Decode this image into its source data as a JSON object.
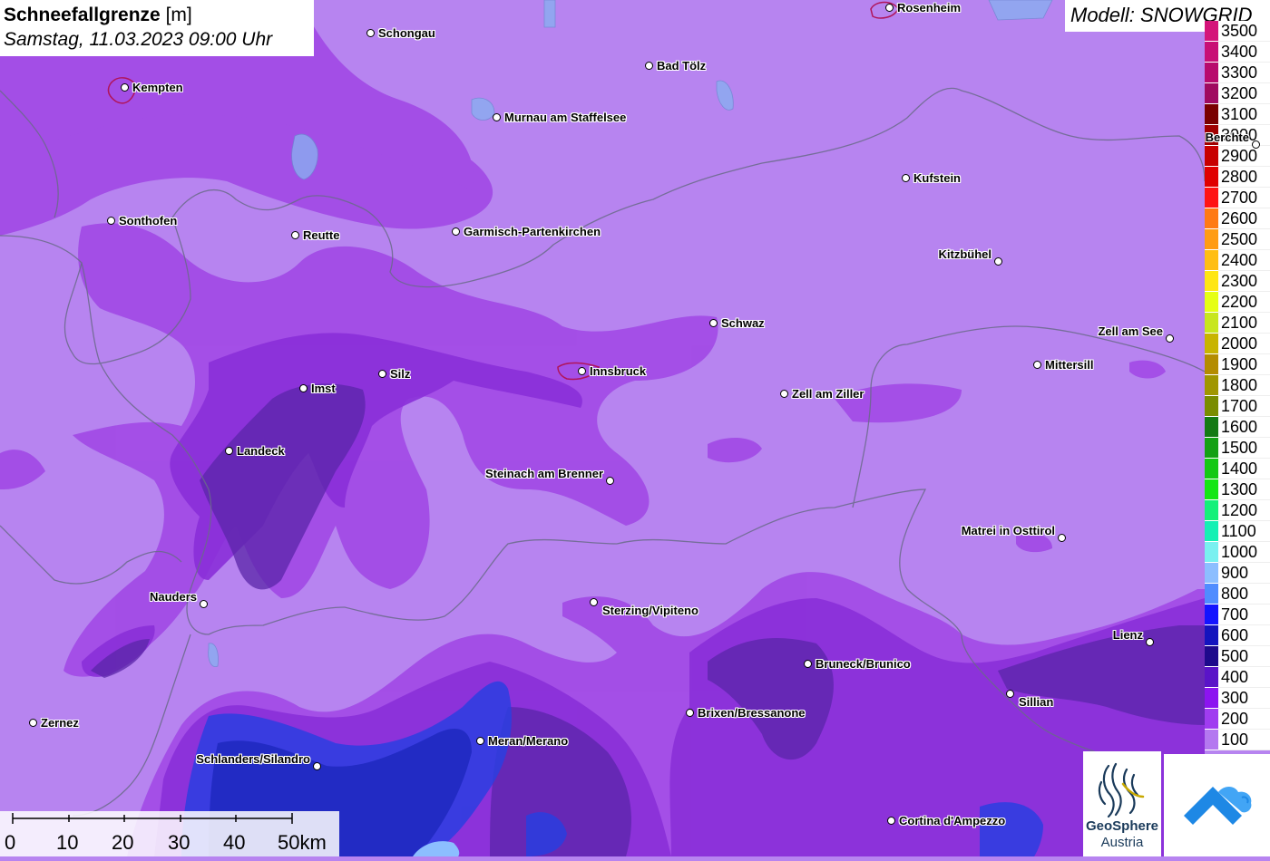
{
  "title": {
    "parameter": "Schneefallgrenze",
    "unit": "[m]",
    "datetime": "Samstag, 11.03.2023 09:00 Uhr"
  },
  "model": "Modell: SNOWGRID",
  "legend": {
    "levels": [
      {
        "label": "3500",
        "color": "#d4147a"
      },
      {
        "label": "3400",
        "color": "#c80f75"
      },
      {
        "label": "3300",
        "color": "#b80a6d"
      },
      {
        "label": "3200",
        "color": "#a00a60"
      },
      {
        "label": "3100",
        "color": "#7a0000"
      },
      {
        "label": "3000",
        "color": "#a00000"
      },
      {
        "label": "2900",
        "color": "#c80000"
      },
      {
        "label": "2800",
        "color": "#e00000"
      },
      {
        "label": "2700",
        "color": "#ff1414"
      },
      {
        "label": "2600",
        "color": "#ff7a14"
      },
      {
        "label": "2500",
        "color": "#ff9c14"
      },
      {
        "label": "2400",
        "color": "#ffbe14"
      },
      {
        "label": "2300",
        "color": "#ffe614"
      },
      {
        "label": "2200",
        "color": "#e6ff14"
      },
      {
        "label": "2100",
        "color": "#c8e61e"
      },
      {
        "label": "2000",
        "color": "#c8b400"
      },
      {
        "label": "1900",
        "color": "#b48c00"
      },
      {
        "label": "1800",
        "color": "#a09600"
      },
      {
        "label": "1700",
        "color": "#7a8c00"
      },
      {
        "label": "1600",
        "color": "#147a14"
      },
      {
        "label": "1500",
        "color": "#14a014"
      },
      {
        "label": "1400",
        "color": "#14c814"
      },
      {
        "label": "1300",
        "color": "#14e614"
      },
      {
        "label": "1200",
        "color": "#14f07a"
      },
      {
        "label": "1100",
        "color": "#14f0b4"
      },
      {
        "label": "1000",
        "color": "#7af0f0"
      },
      {
        "label": "900",
        "color": "#8cbeff"
      },
      {
        "label": "800",
        "color": "#508cff"
      },
      {
        "label": "700",
        "color": "#1414ff"
      },
      {
        "label": "600",
        "color": "#1414be"
      },
      {
        "label": "500",
        "color": "#1e0a8c"
      },
      {
        "label": "400",
        "color": "#5a14c8"
      },
      {
        "label": "300",
        "color": "#8c14f0"
      },
      {
        "label": "200",
        "color": "#a03cf0"
      },
      {
        "label": "100",
        "color": "#b478f0"
      }
    ]
  },
  "cities": [
    {
      "name": "Rosenheim"
    },
    {
      "name": "Schongau"
    },
    {
      "name": "Bad Tölz"
    },
    {
      "name": "Kempten"
    },
    {
      "name": "Murnau am Staffelsee"
    },
    {
      "name": "Berchte"
    },
    {
      "name": "Kufstein"
    },
    {
      "name": "Sonthofen"
    },
    {
      "name": "Reutte"
    },
    {
      "name": "Garmisch-Partenkirchen"
    },
    {
      "name": "Kitzbühel"
    },
    {
      "name": "Schwaz"
    },
    {
      "name": "Zell am See"
    },
    {
      "name": "Mittersill"
    },
    {
      "name": "Silz"
    },
    {
      "name": "Innsbruck"
    },
    {
      "name": "Imst"
    },
    {
      "name": "Zell am Ziller"
    },
    {
      "name": "Landeck"
    },
    {
      "name": "Steinach am Brenner"
    },
    {
      "name": "Matrei in Osttirol"
    },
    {
      "name": "Nauders"
    },
    {
      "name": "Sterzing/Vipiteno"
    },
    {
      "name": "Lienz"
    },
    {
      "name": "Bruneck/Brunico"
    },
    {
      "name": "Sillian"
    },
    {
      "name": "Brixen/Bressanone"
    },
    {
      "name": "Zernez"
    },
    {
      "name": "Meran/Merano"
    },
    {
      "name": "Schlanders/Silandro"
    },
    {
      "name": "Cortina d'Ampezzo"
    }
  ],
  "scale": {
    "labels": [
      "0",
      "10",
      "20",
      "30",
      "40",
      "50km"
    ]
  },
  "logos": {
    "geosphere_line1": "GeoSphere",
    "geosphere_line2": "Austria"
  }
}
